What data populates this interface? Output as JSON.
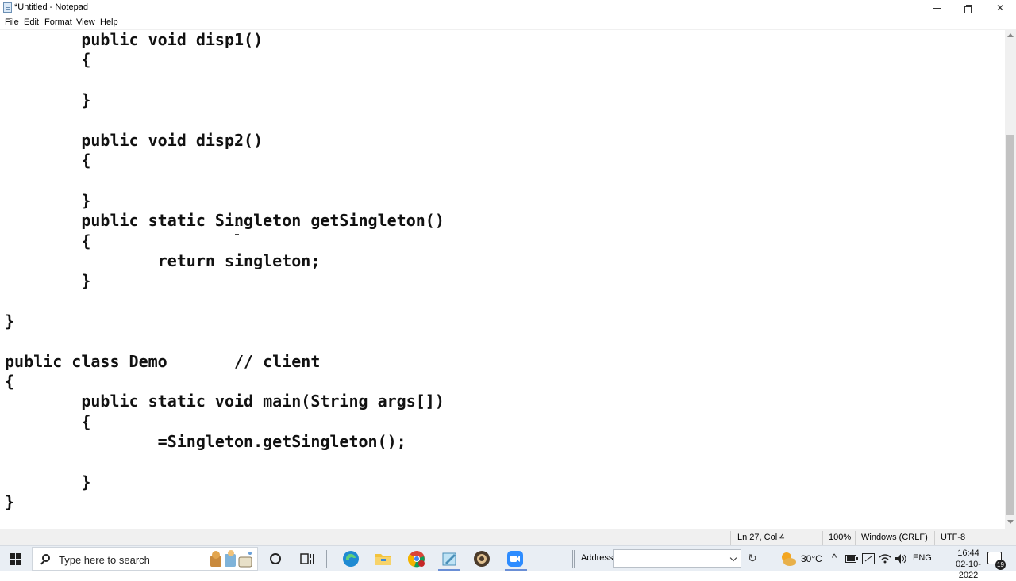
{
  "window": {
    "title": "*Untitled - Notepad",
    "minimize_glyph": "",
    "close_glyph": "✕"
  },
  "menu": [
    "File",
    "Edit",
    "Format",
    "View",
    "Help"
  ],
  "code_lines": [
    "        public void disp1()",
    "        {",
    "",
    "        }",
    "",
    "        public void disp2()",
    "        {",
    "",
    "        }",
    "        public static Singleton getSingleton()",
    "        {",
    "                return singleton;",
    "        }",
    "",
    "}",
    "",
    "public class Demo       // client",
    "{",
    "        public static void main(String args[])",
    "        {",
    "                =Singleton.getSingleton();",
    "",
    "        }",
    "}"
  ],
  "status": {
    "position": "Ln 27, Col 4",
    "zoom": "100%",
    "line_ending": "Windows (CRLF)",
    "encoding": "UTF-8"
  },
  "taskbar": {
    "search_placeholder": "Type here to search",
    "address_label": "Address",
    "address_value": "",
    "weather": "30°C",
    "language": "ENG",
    "time": "16:44",
    "date": "02-10-2022",
    "notification_count": "19"
  }
}
